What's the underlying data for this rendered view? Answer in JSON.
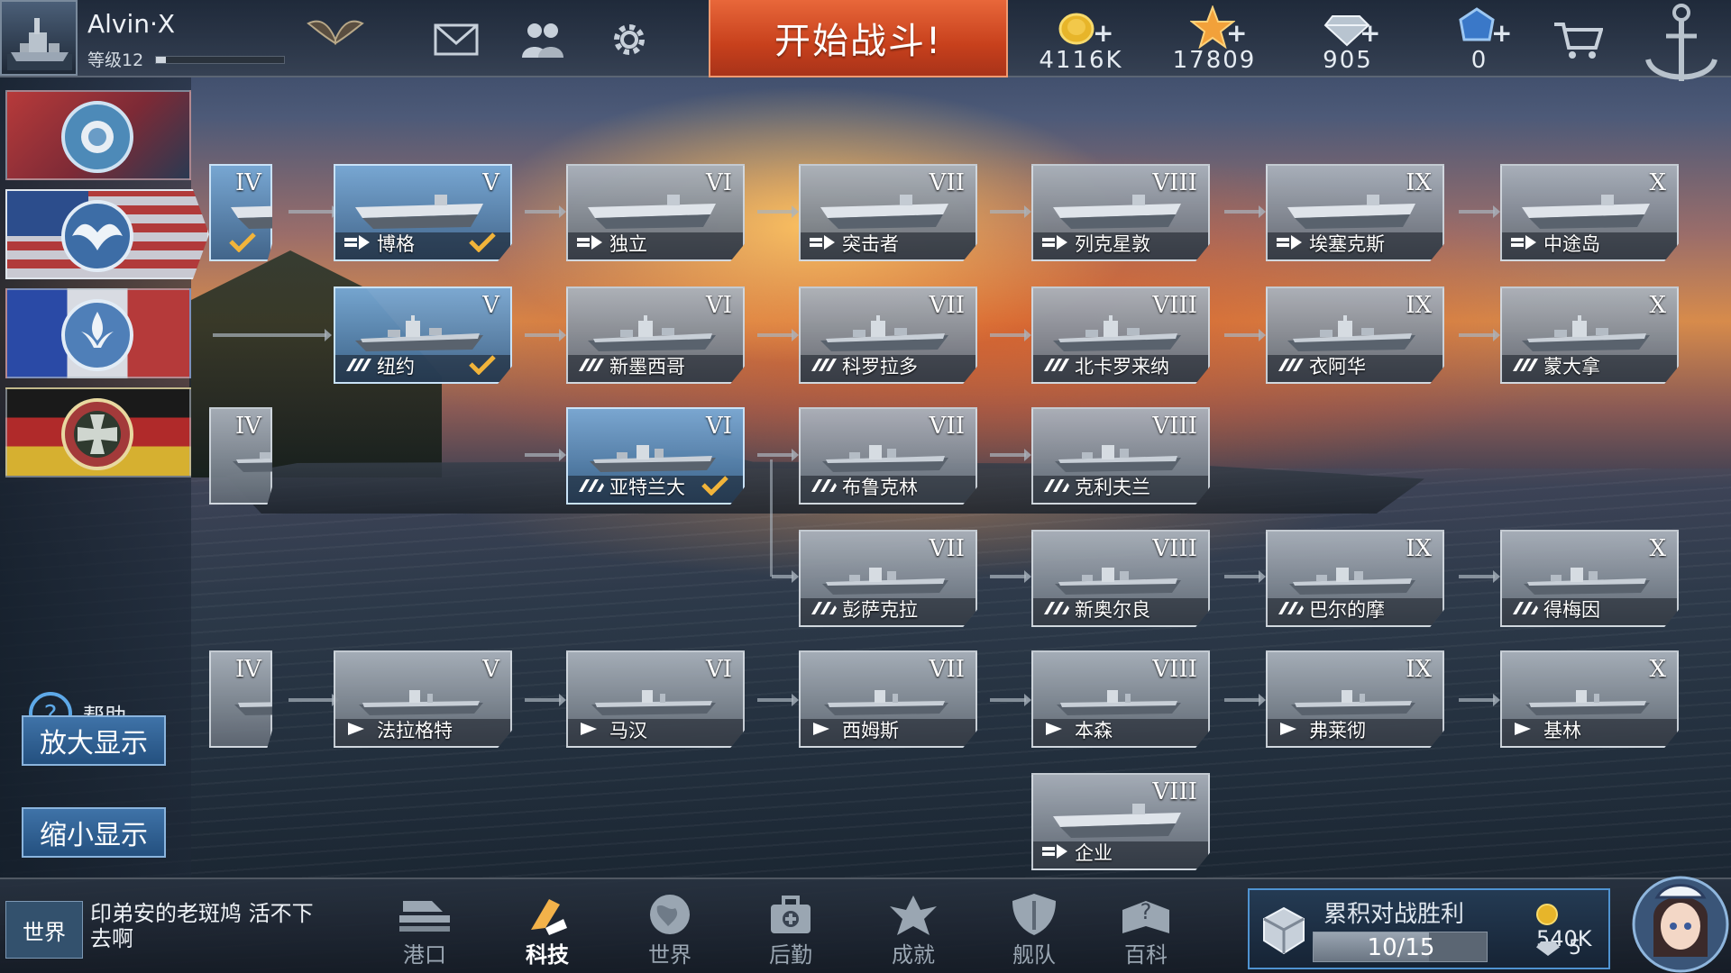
{
  "player": {
    "name": "Alvin·X",
    "level_label": "等级12",
    "xp_fraction": 0.08
  },
  "top": {
    "battle_label": "开始战斗!",
    "resources": [
      {
        "name": "gold",
        "icon": "gold-coin-icon",
        "value": "4116K"
      },
      {
        "name": "star",
        "icon": "star-icon",
        "value": "17809"
      },
      {
        "name": "diamond",
        "icon": "diamond-icon",
        "value": "905"
      },
      {
        "name": "blue-gem",
        "icon": "blue-gem-icon",
        "value": "0"
      }
    ]
  },
  "sidebar": {
    "nations": [
      {
        "name": "japan",
        "icon": "japan-emblem-icon",
        "active": false
      },
      {
        "name": "usa",
        "icon": "usa-eagle-emblem-icon",
        "active": true
      },
      {
        "name": "france",
        "icon": "france-lily-emblem-icon",
        "active": false
      },
      {
        "name": "germany",
        "icon": "germany-cross-emblem-icon",
        "active": false
      }
    ],
    "help_label": "帮助",
    "zoom_in_label": "放大显示",
    "zoom_out_label": "缩小显示"
  },
  "tree": {
    "cells": [
      {
        "tier": "IV",
        "name": "",
        "type": "carrier",
        "owned": true,
        "checked": true,
        "partial": true
      },
      {
        "tier": "V",
        "name": "博格",
        "type": "carrier",
        "owned": true,
        "checked": true
      },
      {
        "tier": "VI",
        "name": "独立",
        "type": "carrier",
        "owned": false,
        "checked": false
      },
      {
        "tier": "VII",
        "name": "突击者",
        "type": "carrier",
        "owned": false,
        "checked": false
      },
      {
        "tier": "VIII",
        "name": "列克星敦",
        "type": "carrier",
        "owned": false,
        "checked": false
      },
      {
        "tier": "IX",
        "name": "埃塞克斯",
        "type": "carrier",
        "owned": false,
        "checked": false
      },
      {
        "tier": "X",
        "name": "中途岛",
        "type": "carrier",
        "owned": false,
        "checked": false
      },
      {
        "tier": "V",
        "name": "纽约",
        "type": "battleship",
        "owned": true,
        "checked": true
      },
      {
        "tier": "VI",
        "name": "新墨西哥",
        "type": "battleship",
        "owned": false,
        "checked": false
      },
      {
        "tier": "VII",
        "name": "科罗拉多",
        "type": "battleship",
        "owned": false,
        "checked": false
      },
      {
        "tier": "VIII",
        "name": "北卡罗来纳",
        "type": "battleship",
        "owned": false,
        "checked": false
      },
      {
        "tier": "IX",
        "name": "衣阿华",
        "type": "battleship",
        "owned": false,
        "checked": false
      },
      {
        "tier": "X",
        "name": "蒙大拿",
        "type": "battleship",
        "owned": false,
        "checked": false
      },
      {
        "tier": "IV",
        "name": "",
        "type": "cruiser",
        "owned": false,
        "checked": false,
        "partial": true
      },
      {
        "tier": "VI",
        "name": "亚特兰大",
        "type": "cruiser",
        "owned": true,
        "checked": true
      },
      {
        "tier": "VII",
        "name": "布鲁克林",
        "type": "cruiser",
        "owned": false,
        "checked": false
      },
      {
        "tier": "VIII",
        "name": "克利夫兰",
        "type": "cruiser",
        "owned": false,
        "checked": false
      },
      {
        "tier": "VII",
        "name": "彭萨克拉",
        "type": "cruiser",
        "owned": false,
        "checked": false
      },
      {
        "tier": "VIII",
        "name": "新奥尔良",
        "type": "cruiser",
        "owned": false,
        "checked": false
      },
      {
        "tier": "IX",
        "name": "巴尔的摩",
        "type": "cruiser",
        "owned": false,
        "checked": false
      },
      {
        "tier": "X",
        "name": "得梅因",
        "type": "cruiser",
        "owned": false,
        "checked": false
      },
      {
        "tier": "IV",
        "name": "",
        "type": "destroyer",
        "owned": false,
        "checked": false,
        "partial": true
      },
      {
        "tier": "V",
        "name": "法拉格特",
        "type": "destroyer",
        "owned": false,
        "checked": false
      },
      {
        "tier": "VI",
        "name": "马汉",
        "type": "destroyer",
        "owned": false,
        "checked": false
      },
      {
        "tier": "VII",
        "name": "西姆斯",
        "type": "destroyer",
        "owned": false,
        "checked": false
      },
      {
        "tier": "VIII",
        "name": "本森",
        "type": "destroyer",
        "owned": false,
        "checked": false
      },
      {
        "tier": "IX",
        "name": "弗莱彻",
        "type": "destroyer",
        "owned": false,
        "checked": false
      },
      {
        "tier": "X",
        "name": "基林",
        "type": "destroyer",
        "owned": false,
        "checked": false
      },
      {
        "tier": "VIII",
        "name": "企业",
        "type": "carrier",
        "owned": false,
        "checked": false
      }
    ]
  },
  "bottom": {
    "chat_channel": "世界",
    "chat_message": "印弟安的老斑鸠 活不下去啊",
    "nav": [
      {
        "label": "港口",
        "icon": "harbor-icon",
        "active": false
      },
      {
        "label": "科技",
        "icon": "tech-icon",
        "active": true
      },
      {
        "label": "世界",
        "icon": "globe-icon",
        "active": false
      },
      {
        "label": "后勤",
        "icon": "logistics-icon",
        "active": false
      },
      {
        "label": "成就",
        "icon": "achievement-icon",
        "active": false
      },
      {
        "label": "舰队",
        "icon": "fleet-shield-icon",
        "active": false
      },
      {
        "label": "百科",
        "icon": "encyclopedia-icon",
        "active": false
      }
    ],
    "victory": {
      "title": "累积对战胜利",
      "progress_text": "10/15",
      "progress_fraction": 0.667,
      "gold_reward": "540K",
      "gem_reward": "5"
    }
  }
}
